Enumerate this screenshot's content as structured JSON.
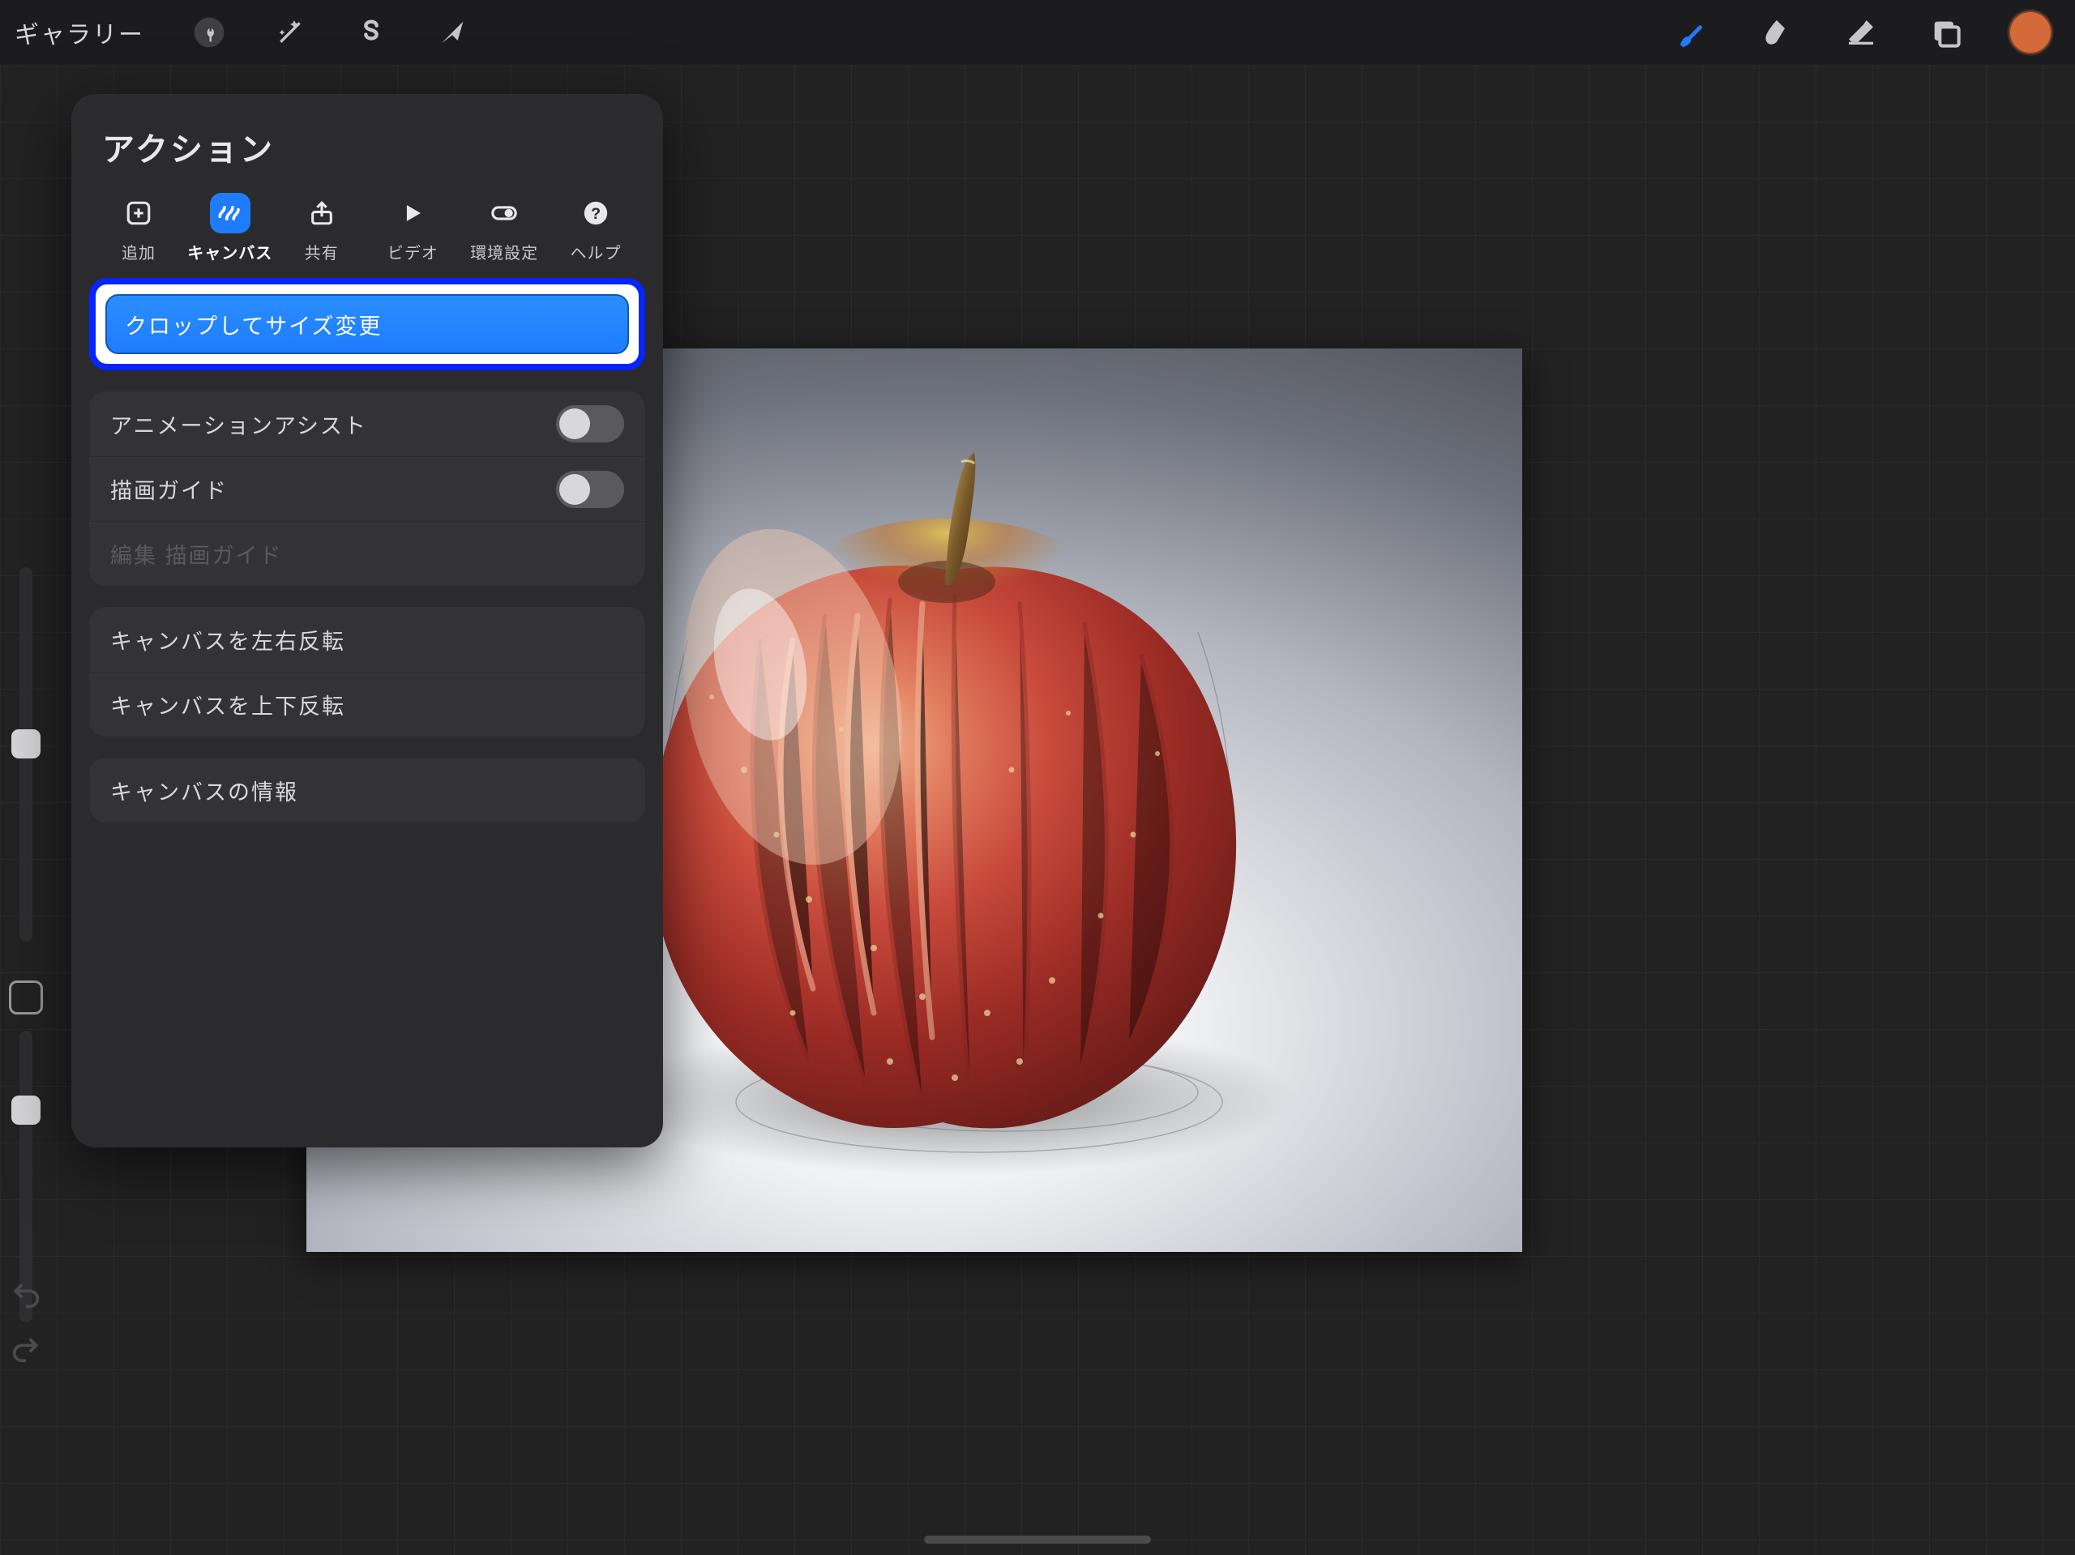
{
  "toolbar": {
    "gallery_label": "ギャラリー"
  },
  "panel": {
    "title": "アクション",
    "tabs": {
      "add": {
        "label": "追加"
      },
      "canvas": {
        "label": "キャンバス"
      },
      "share": {
        "label": "共有"
      },
      "video": {
        "label": "ビデオ"
      },
      "prefs": {
        "label": "環境設定"
      },
      "help": {
        "label": "ヘルプ"
      }
    },
    "highlighted_item": "クロップしてサイズ変更",
    "items": {
      "animation_assist": "アニメーションアシスト",
      "drawing_guide": "描画ガイド",
      "edit_drawing_guide": "編集 描画ガイド",
      "flip_h": "キャンバスを左右反転",
      "flip_v": "キャンバスを上下反転",
      "canvas_info": "キャンバスの情報"
    }
  },
  "colors": {
    "swatch": "#d46a3a"
  }
}
